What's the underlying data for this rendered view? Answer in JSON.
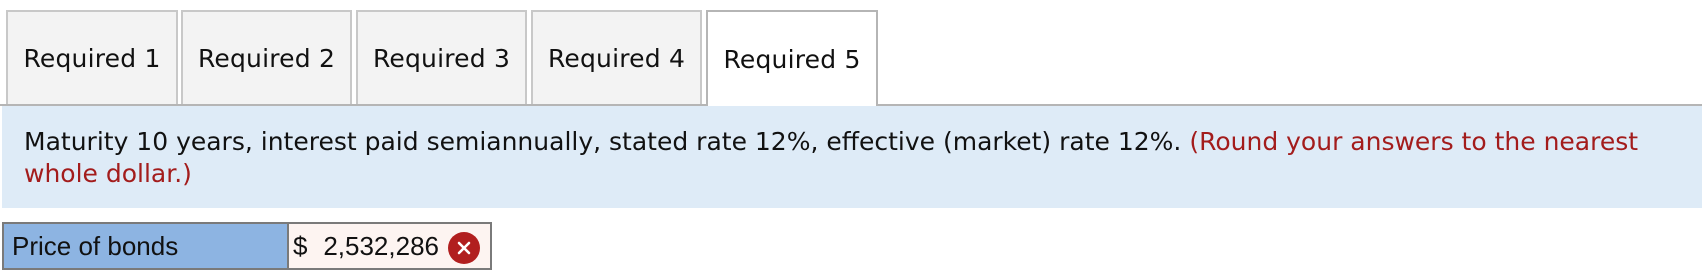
{
  "tabs": [
    {
      "label": "Required 1",
      "active": false
    },
    {
      "label": "Required 2",
      "active": false
    },
    {
      "label": "Required 3",
      "active": false
    },
    {
      "label": "Required 4",
      "active": false
    },
    {
      "label": "Required 5",
      "active": true
    }
  ],
  "instruction": {
    "text": "Maturity 10 years, interest paid semiannually, stated rate 12%, effective (market) rate 12%.",
    "note": "(Round your answers to the nearest whole dollar.)"
  },
  "answer": {
    "label": "Price of bonds",
    "currency": "$",
    "value": "2,532,286",
    "status_icon": "incorrect-x-icon",
    "status_color": "#b11f1f"
  },
  "colors": {
    "instruction_bg": "#deebf7",
    "note_text": "#a31c1c",
    "label_bg": "#8db4e2",
    "inactive_tab_bg": "#f3f3f3"
  }
}
